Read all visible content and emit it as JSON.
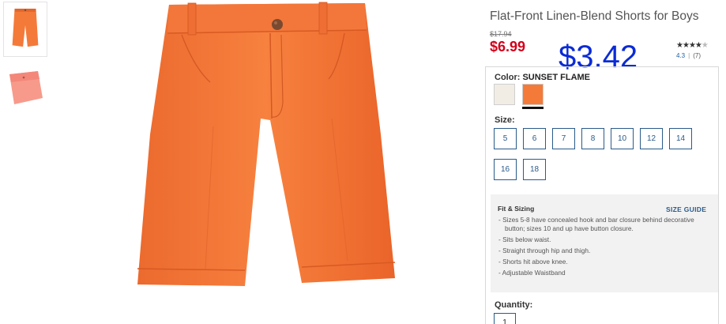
{
  "thumbnails": [
    {
      "alt": "shorts-front-thumbnail",
      "active": true
    },
    {
      "alt": "shorts-folded-thumbnail",
      "active": false
    }
  ],
  "product": {
    "title": "Flat-Front Linen-Blend Shorts for Boys",
    "original_price": "$17.94",
    "sale_price": "$6.99",
    "overlay_price": "$3.42",
    "rating_value": "4.3",
    "rating_separator": "|",
    "review_count": "(7)",
    "rating_stars": 4.3
  },
  "color": {
    "label": "Color:",
    "selected": "SUNSET FLAME",
    "swatches": [
      {
        "name": "cream",
        "hex": "#f1ede4",
        "selected": false
      },
      {
        "name": "sunset-flame",
        "hex": "#f47a3a",
        "selected": true
      }
    ]
  },
  "size": {
    "label": "Size:",
    "options": [
      "5",
      "6",
      "7",
      "8",
      "10",
      "12",
      "14",
      "16",
      "18"
    ]
  },
  "fit": {
    "title": "Fit & Sizing",
    "guide_link": "SIZE GUIDE",
    "items": [
      "Sizes 5-8 have concealed hook and bar closure behind decorative button; sizes 10 and up have button closure.",
      "Sits below waist.",
      "Straight through hip and thigh.",
      "Shorts hit above knee.",
      "Adjustable Waistband"
    ]
  },
  "quantity": {
    "label": "Quantity:",
    "value": "1"
  },
  "colors": {
    "sale": "#d2001a",
    "overlay": "#0a2bd6",
    "link": "#2a5b8a",
    "product": "#f47a3a"
  }
}
